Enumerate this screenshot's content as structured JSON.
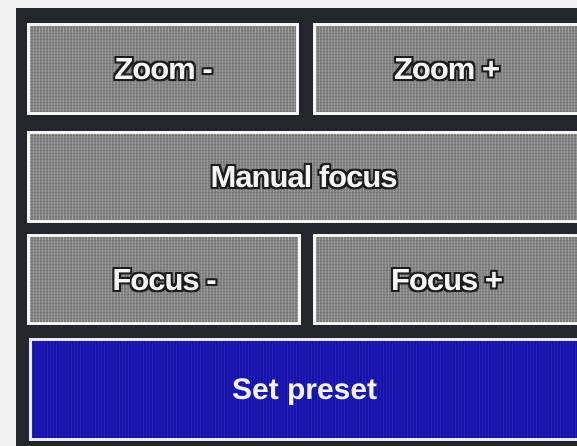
{
  "panel": {
    "zoom_minus_label": "Zoom -",
    "zoom_plus_label": "Zoom +",
    "manual_focus_label": "Manual focus",
    "focus_minus_label": "Focus -",
    "focus_plus_label": "Focus +",
    "set_preset_label": "Set preset"
  },
  "colors": {
    "panel_background": "#252629",
    "button_gray": "#8c8c8c",
    "button_border": "#f4f4f4",
    "active_button_blue": "#1a14b2",
    "label_text": "#f6f6f6"
  }
}
